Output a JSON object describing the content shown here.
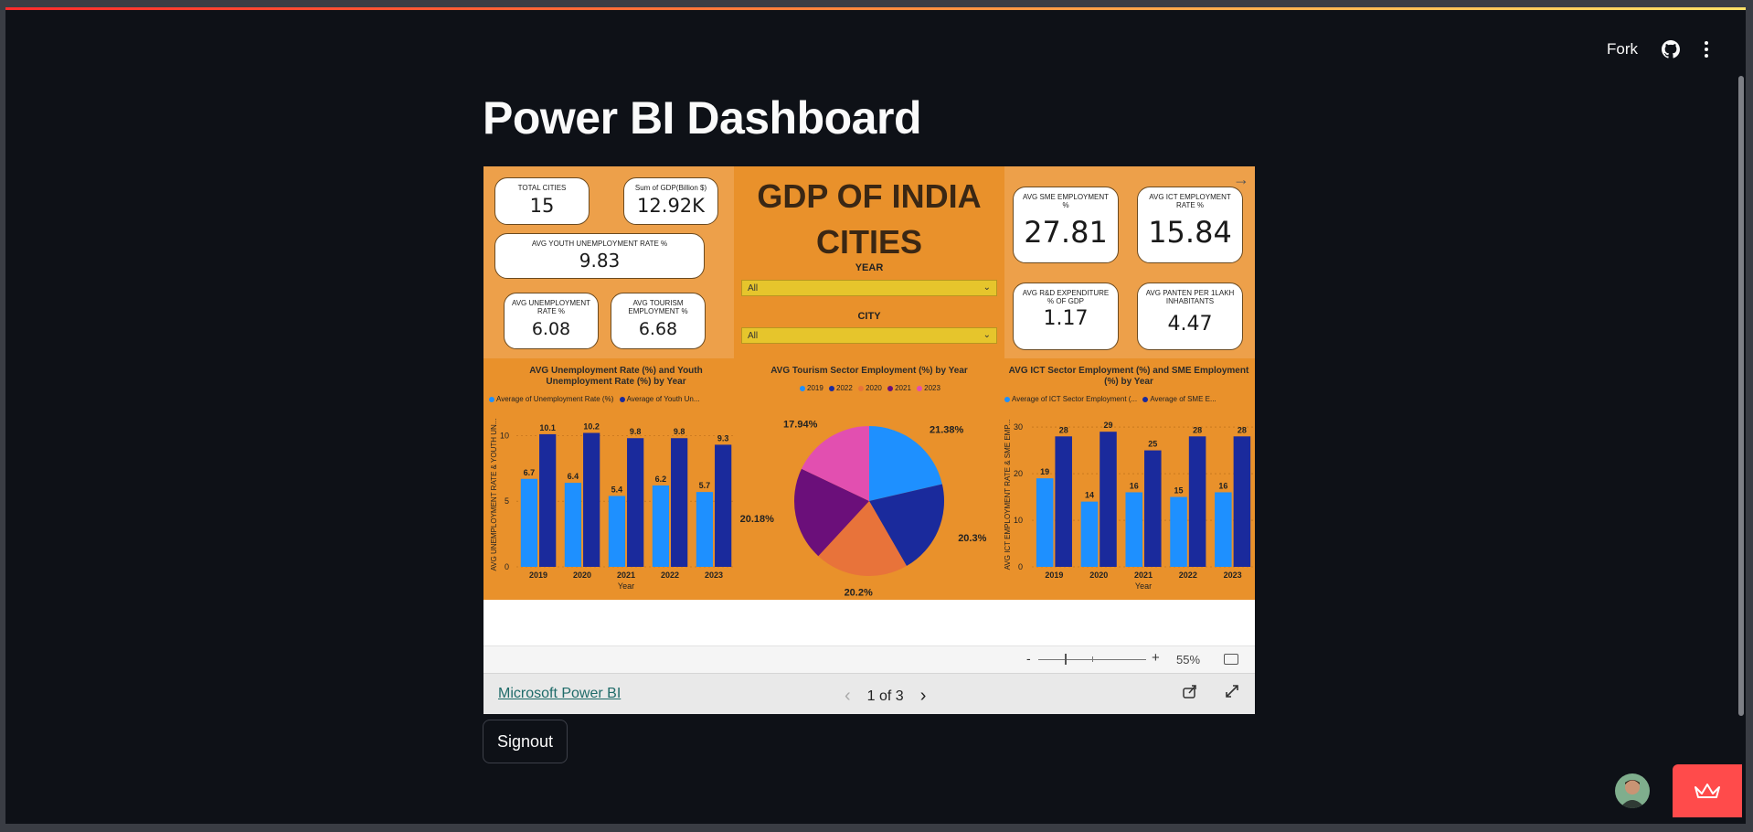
{
  "header": {
    "fork_label": "Fork",
    "github_icon": "github-icon",
    "menu_icon": "kebab-menu-icon"
  },
  "page": {
    "title": "Power BI Dashboard"
  },
  "report": {
    "title": "GDP OF INDIA CITIES",
    "kpis": {
      "total_cities": {
        "label": "TOTAL CITIES",
        "value": "15"
      },
      "gdp_sum": {
        "label": "Sum of GDP(Billion $)",
        "value": "12.92K"
      },
      "youth_unemployment": {
        "label": "AVG YOUTH UNEMPLOYMENT RATE %",
        "value": "9.83"
      },
      "unemployment": {
        "label": "AVG UNEMPLOYMENT RATE %",
        "value": "6.08"
      },
      "tourism": {
        "label": "AVG TOURISM EMPLOYMENT %",
        "value": "6.68"
      },
      "sme": {
        "label": "AVG SME EMPLOYMENT %",
        "value": "27.81"
      },
      "ict": {
        "label": "AVG ICT EMPLOYMENT RATE %",
        "value": "15.84"
      },
      "rnd": {
        "label": "AVG R&D EXPENDITURE % OF GDP",
        "value": "1.17"
      },
      "patent": {
        "label": "AVG PANTEN PER 1LAKH INHABITANTS",
        "value": "4.47"
      }
    },
    "slicers": {
      "year": {
        "label": "YEAR",
        "value": "All"
      },
      "city": {
        "label": "CITY",
        "value": "All"
      }
    }
  },
  "chart_data": [
    {
      "type": "bar",
      "title": "AVG Unemployment Rate (%) and Youth Unemployment Rate (%) by Year",
      "xlabel": "Year",
      "ylabel": "AVG UNEMPLOYMENT RATE & YOUTH UN...",
      "categories": [
        "2019",
        "2020",
        "2021",
        "2022",
        "2023"
      ],
      "ylim": [
        0,
        11
      ],
      "yticks": [
        "0",
        "5",
        "10"
      ],
      "series": [
        {
          "name": "Average of Unemployment Rate (%)",
          "color": "#1e90ff",
          "values": [
            6.7,
            6.4,
            5.4,
            6.2,
            5.7
          ],
          "labels": [
            "6.7",
            "6.4",
            "5.4",
            "6.2",
            "5.7"
          ]
        },
        {
          "name": "Average of Youth Un...",
          "color": "#1a2a9c",
          "values": [
            10.1,
            10.2,
            9.8,
            9.8,
            9.3
          ],
          "labels": [
            "10.1",
            "10.2",
            "9.8",
            "9.8",
            "9.3"
          ]
        }
      ]
    },
    {
      "type": "pie",
      "title": "AVG Tourism Sector Employment (%) by Year",
      "legend": [
        "2019",
        "2022",
        "2020",
        "2021",
        "2023"
      ],
      "slices": [
        {
          "label": "2019",
          "value": 21.38,
          "text": "21.38%",
          "color": "#1e90ff"
        },
        {
          "label": "2022",
          "value": 20.3,
          "text": "20.3%",
          "color": "#1a2a9c"
        },
        {
          "label": "2020",
          "value": 20.2,
          "text": "20.2%",
          "color": "#e8733a"
        },
        {
          "label": "2021",
          "value": 20.18,
          "text": "20.18%",
          "color": "#6b0f7a"
        },
        {
          "label": "2023",
          "value": 17.94,
          "text": "17.94%",
          "color": "#e24fb0"
        }
      ]
    },
    {
      "type": "bar",
      "title": "AVG ICT Sector Employment (%) and SME Employment (%) by Year",
      "xlabel": "Year",
      "ylabel": "AVG ICT EMPLOYMENT RATE & SME EMP...",
      "categories": [
        "2019",
        "2020",
        "2021",
        "2022",
        "2023"
      ],
      "ylim": [
        0,
        31
      ],
      "yticks": [
        "0",
        "10",
        "20",
        "30"
      ],
      "series": [
        {
          "name": "Average of ICT Sector Employment (...",
          "color": "#1e90ff",
          "values": [
            19,
            14,
            16,
            15,
            16
          ],
          "labels": [
            "19",
            "14",
            "16",
            "15",
            "16"
          ]
        },
        {
          "name": "Average of SME E...",
          "color": "#1a2a9c",
          "values": [
            28,
            29,
            25,
            28,
            28
          ],
          "labels": [
            "28",
            "29",
            "25",
            "28",
            "28"
          ]
        }
      ]
    }
  ],
  "zoom": {
    "minus": "-",
    "plus": "+",
    "level": "55%",
    "value_percent": 55
  },
  "footer": {
    "link": "Microsoft Power BI",
    "page_indicator": "1 of 3",
    "prev": "‹",
    "next": "›"
  },
  "signout_label": "Signout"
}
